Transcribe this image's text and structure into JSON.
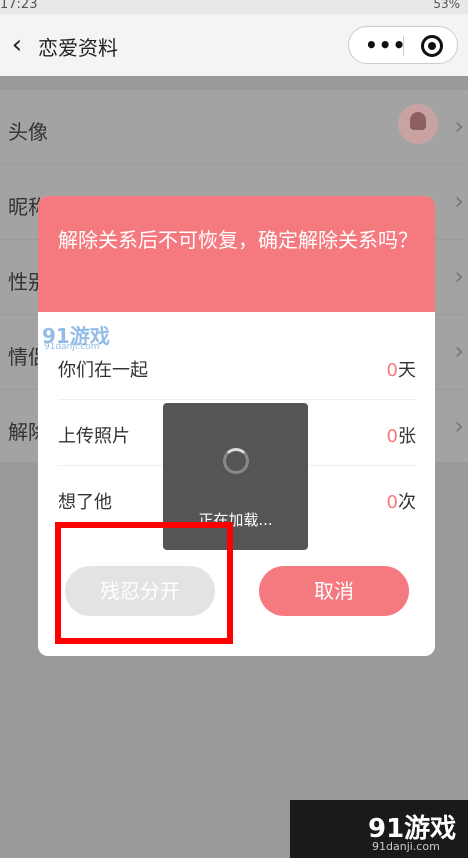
{
  "status_bar": {
    "time": "17:23",
    "battery": "53%"
  },
  "header": {
    "title": "恋爱资料"
  },
  "list": {
    "items": [
      {
        "label": "头像"
      },
      {
        "label": "昵称"
      },
      {
        "label": "性别"
      },
      {
        "label": "情侣"
      },
      {
        "label": "解除"
      }
    ]
  },
  "dialog": {
    "title": "解除关系后不可恢复，确定解除关系吗？",
    "stats": [
      {
        "label": "你们在一起",
        "value": "0",
        "unit": "天"
      },
      {
        "label": "上传照片",
        "value": "0",
        "unit": "张"
      },
      {
        "label": "想了他",
        "value": "0",
        "unit": "次"
      }
    ],
    "confirm_label": "残忍分开",
    "cancel_label": "取消"
  },
  "toast": {
    "text": "正在加载..."
  },
  "watermark": {
    "brand": "91游戏",
    "site": "91danji.com"
  },
  "colors": {
    "accent": "#f57a80",
    "highlight": "#ff0000"
  }
}
